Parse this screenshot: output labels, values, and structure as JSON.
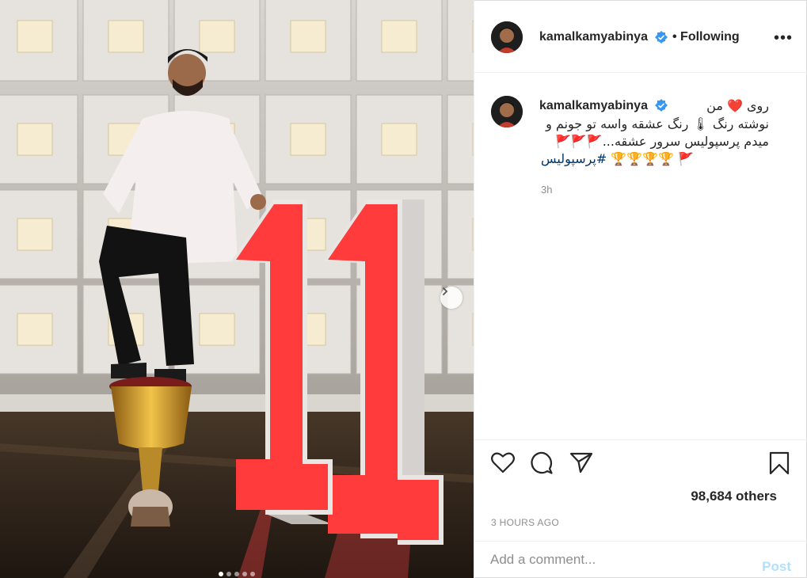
{
  "post": {
    "username": "kamalkamyabinya",
    "verified": true,
    "following_label": "• Following",
    "more_icon": "more-horizontal-icon"
  },
  "caption": {
    "username": "kamalkamyabinya",
    "line1": "روی ❤️ من",
    "line2": "نوشته رنگ 🌡 رنگ عشقه واسه تو جونم و",
    "line3": "میدم پرسپولیس سرور عشقه...🚩🚩🚩",
    "line4_trophies": "🚩 🏆🏆🏆🏆",
    "line4_hashtag": "#پرسپولیس",
    "time": "3h"
  },
  "actions": {
    "like_icon": "heart-icon",
    "comment_icon": "comment-icon",
    "share_icon": "paper-plane-icon",
    "save_icon": "bookmark-icon",
    "likes": "98,684 others",
    "time_ago": "3 HOURS AGO"
  },
  "comment_box": {
    "placeholder": "Add a comment...",
    "post_label": "Post"
  },
  "carousel": {
    "slides": 5,
    "active_slide": 1,
    "next_icon": "chevron-right-icon"
  },
  "colors": {
    "accent_blue": "#0095f6",
    "post_disabled": "#b2dffc",
    "number_red": "#ff3b3b"
  }
}
